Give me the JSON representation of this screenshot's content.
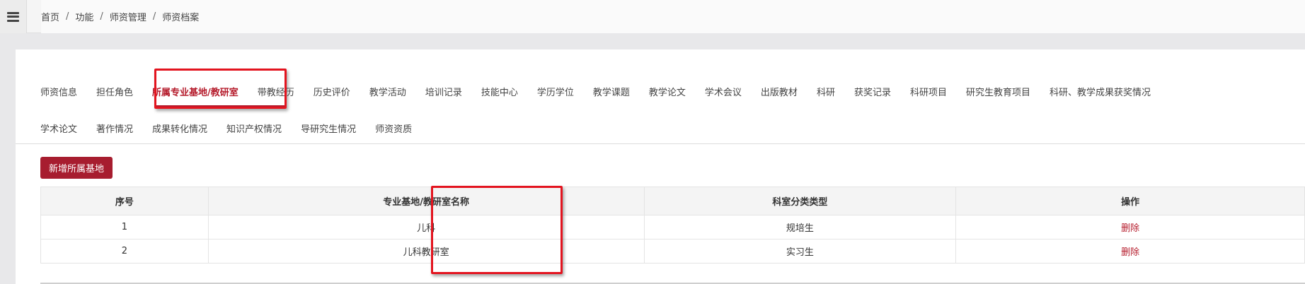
{
  "breadcrumb": [
    "首页",
    "功能",
    "师资管理",
    "师资档案"
  ],
  "breadcrumb_separator": "/",
  "tabs_row1": [
    "师资信息",
    "担任角色",
    "所属专业基地/教研室",
    "带教经历",
    "历史评价",
    "教学活动",
    "培训记录",
    "技能中心",
    "学历学位",
    "教学课题",
    "教学论文",
    "学术会议",
    "出版教材",
    "科研",
    "获奖记录",
    "科研项目",
    "研究生教育项目",
    "科研、教学成果获奖情况"
  ],
  "tabs_row2": [
    "学术论文",
    "著作情况",
    "成果转化情况",
    "知识产权情况",
    "导研究生情况",
    "师资资质"
  ],
  "active_tab": "所属专业基地/教研室",
  "add_button_label": "新增所属基地",
  "table": {
    "headers": [
      "序号",
      "专业基地/教研室名称",
      "科室分类类型",
      "操作"
    ],
    "rows": [
      {
        "index": "1",
        "name": "儿科",
        "type": "规培生",
        "action": "删除"
      },
      {
        "index": "2",
        "name": "儿科教研室",
        "type": "实习生",
        "action": "删除"
      }
    ]
  },
  "colors": {
    "accent": "#b51c2c",
    "button_bg": "#a71d2f",
    "highlight_box": "#e3141f"
  }
}
